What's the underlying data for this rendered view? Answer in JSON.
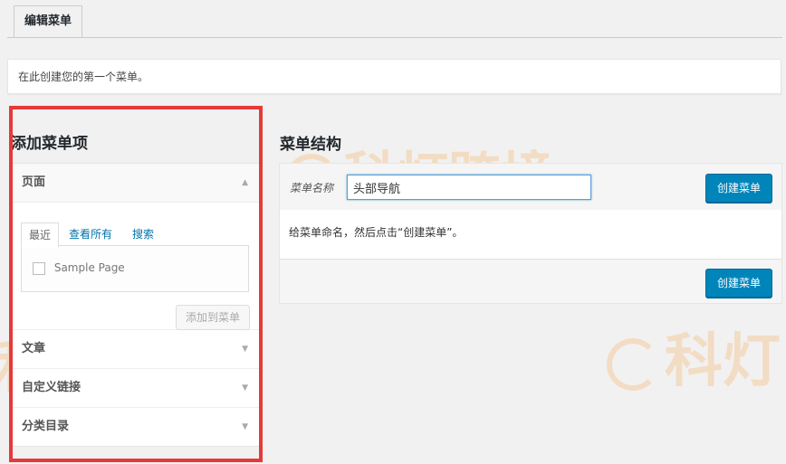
{
  "tabs": {
    "active_label": "编辑菜单"
  },
  "notice": {
    "text": "在此创建您的第一个菜单。"
  },
  "watermark": {
    "text": "科灯跨境",
    "text_short": "科灯",
    "color": "#f5c48c"
  },
  "left": {
    "heading": "添加菜单项",
    "sections": [
      {
        "label": "页面",
        "state": "expanded"
      },
      {
        "label": "文章",
        "state": "collapsed"
      },
      {
        "label": "自定义链接",
        "state": "collapsed"
      },
      {
        "label": "分类目录",
        "state": "collapsed"
      }
    ],
    "pages": {
      "tabs": [
        "最近",
        "查看所有",
        "搜索"
      ],
      "items": [
        "Sample Page"
      ],
      "add_button": "添加到菜单"
    }
  },
  "right": {
    "heading": "菜单结构",
    "name_label": "菜单名称",
    "name_value": "头部导航",
    "create_button": "创建菜单",
    "instruction": "给菜单命名，然后点击“创建菜单”。"
  },
  "colors": {
    "primary": "#0085ba",
    "highlight": "#e53a3a"
  }
}
